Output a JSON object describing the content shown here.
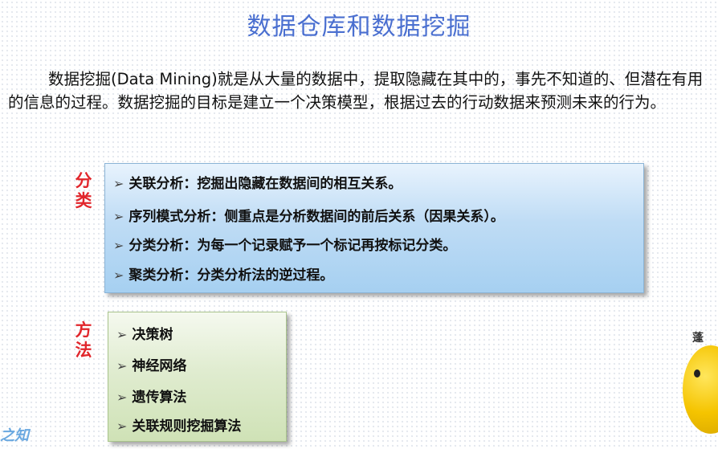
{
  "slide": {
    "title": "数据仓库和数据挖掘",
    "paragraph": "数据挖掘(Data Mining)就是从大量的数据中，提取隐藏在其中的，事先不知道的、但潜在有用的信息的过程。数据挖掘的目标是建立一个决策模型，根据过去的行动数据来预测未来的行为。",
    "classification": {
      "label_1": "分",
      "label_2": "类",
      "items": [
        "关联分析：挖掘出隐藏在数据间的相互关系。",
        "序列模式分析：侧重点是分析数据间的前后关系（因果关系）。",
        "分类分析：为每一个记录赋予一个标记再按标记分类。",
        "聚类分析：分类分析法的逆过程。"
      ]
    },
    "methods": {
      "label_1": "方",
      "label_2": "法",
      "items": [
        "决策树",
        "神经网络",
        "遗传算法",
        "关联规则挖掘算法"
      ]
    },
    "bullet": "➢",
    "mascot_text": "蓬",
    "watermark": "之知"
  },
  "colors": {
    "title": "#4a6fd0",
    "side_label": "#e1262c",
    "box1_fill": "#a6d0f1",
    "box2_fill": "#cfe2b6"
  }
}
